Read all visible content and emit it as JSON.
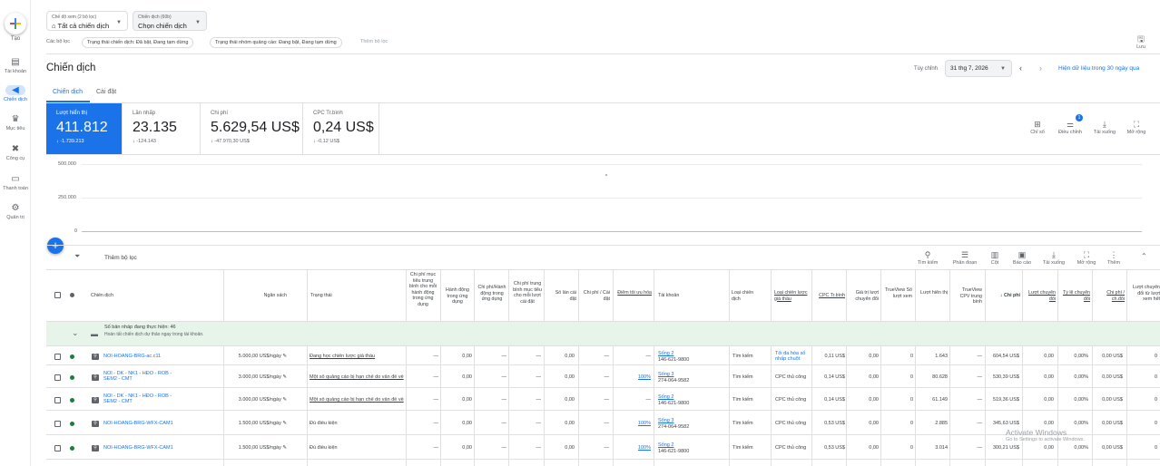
{
  "sidebar": {
    "create_label": "Tạo",
    "items": [
      {
        "label": "Tài khoản",
        "icon": "account-icon"
      },
      {
        "label": "Chiến dịch",
        "icon": "campaign-icon"
      },
      {
        "label": "Mục tiêu",
        "icon": "trophy-icon"
      },
      {
        "label": "Công cụ",
        "icon": "tools-icon"
      },
      {
        "label": "Thanh toán",
        "icon": "billing-icon"
      },
      {
        "label": "Quản trị",
        "icon": "admin-icon"
      }
    ]
  },
  "filters": {
    "view_small": "Chế độ xem (2 bộ lọc)",
    "view_value": "Tất cả chiến dịch",
    "campaign_small": "Chiến dịch (60b)",
    "campaign_value": "Chọn chiến dịch",
    "label": "Các bộ lọc",
    "chips": [
      "Trạng thái chiến dịch: Đã bật, Đang tạm dừng",
      "Trạng thái nhóm quảng cáo: Đang bật, Đang tạm dừng"
    ],
    "add": "Thêm bộ lọc",
    "save": "Lưu"
  },
  "header": {
    "title": "Chiến dịch",
    "custom": "Tùy chỉnh",
    "date": "31 thg 7, 2026",
    "show_30": "Hiện dữ liệu trong 30 ngày qua"
  },
  "tabs": [
    "Chiến dịch",
    "Cài đặt"
  ],
  "metrics": [
    {
      "label": "Lượt hiển thị",
      "value": "411.812",
      "delta": "-1.739.213"
    },
    {
      "label": "Lần nhấp",
      "value": "23.135",
      "delta": "-124.143"
    },
    {
      "label": "Chi phí",
      "value": "5.629,54 US$",
      "delta": "-47.970,30 US$"
    },
    {
      "label": "CPC Tr.bình",
      "value": "0,24 US$",
      "delta": "-0,12 US$"
    }
  ],
  "chart_tools": [
    {
      "label": "Chỉ số",
      "icon": "metrics-icon"
    },
    {
      "label": "Điều chỉnh",
      "icon": "adjust-icon",
      "badge": "1"
    },
    {
      "label": "Tải xuống",
      "icon": "download-icon"
    },
    {
      "label": "Mở rộng",
      "icon": "expand-icon"
    }
  ],
  "chart_data": {
    "type": "line",
    "ylabels": [
      "500.000",
      "250.000",
      "0"
    ],
    "ylim": [
      0,
      500000
    ],
    "series": []
  },
  "table_tools": [
    {
      "label": "Tìm kiếm",
      "icon": "search-icon"
    },
    {
      "label": "Phân đoạn",
      "icon": "segment-icon"
    },
    {
      "label": "Cột",
      "icon": "columns-icon"
    },
    {
      "label": "Báo cáo",
      "icon": "report-icon"
    },
    {
      "label": "Tải xuống",
      "icon": "download-icon"
    },
    {
      "label": "Mở rộng",
      "icon": "expand-icon"
    },
    {
      "label": "Thêm",
      "icon": "more-icon"
    }
  ],
  "add_filter": "Thêm bộ lọc",
  "columns": [
    "Chiến dịch",
    "Ngân sách",
    "Trạng thái",
    "Chi phí mục tiêu trung bình cho mỗi hành động trong ứng dụng",
    "Hành động trong ứng dụng",
    "Chi phí/Hành động trong ứng dụng",
    "Chi phí trung bình mục tiêu cho mỗi lượt cài đặt",
    "Số lần cài đặt",
    "Chi phí / Cài đặt",
    "Điểm tối ưu hóa",
    "Tài khoản",
    "Loại chiến dịch",
    "Loại chiến lược giá thầu",
    "CPC Tr.bình",
    "Giá trị lượt chuyển đổi",
    "TrueView Số lượt xem",
    "Lượt hiển thị",
    "TrueView CPV trung bình",
    "Chi phí",
    "Lượt chuyển đổi",
    "Tỷ lệ chuyển đổi",
    "Chi phí / ch.đổi",
    "Lượt chuyển đổi từ lượt xem hết"
  ],
  "drafts": {
    "title": "Số bản nháp đang thực hiện: 46",
    "sub": "Hoàn tất chiến dịch dự thảo ngay trong tài khoản."
  },
  "rows": [
    {
      "name": "NOI-HOANG-BRG-ac.c11",
      "budget": "5.000,00 US$/ngày",
      "status": "Đang học chiến lược giá thầu",
      "c1": "—",
      "c2": "0,00",
      "c3": "—",
      "c4": "—",
      "c5": "0,00",
      "c6": "—",
      "opt": "—",
      "acct": "Sống 2",
      "acct_id": "146-621-9800",
      "type": "Tìm kiếm",
      "bid": "Tối đa hóa số nhấp chuột",
      "cpc": "0,11 US$",
      "cv": "0,00",
      "tv": "0",
      "impr": "1.643",
      "cpv": "—",
      "cost": "604,54 US$",
      "conv": "0,00",
      "rate": "0,00%",
      "cpa": "0,00 US$",
      "vt": "0"
    },
    {
      "name": "NOI - DK - NK1 - HĐO - ROB - SEM2 - CMT",
      "budget": "3.000,00 US$/ngày",
      "status": "Một số quảng cáo bị hạn chế do vấn đề về",
      "c1": "—",
      "c2": "0,00",
      "c3": "—",
      "c4": "—",
      "c5": "0,00",
      "c6": "—",
      "opt": "100%",
      "acct": "Sống 3",
      "acct_id": "274-064-9582",
      "type": "Tìm kiếm",
      "bid": "CPC thủ công",
      "cpc": "0,14 US$",
      "cv": "0,00",
      "tv": "0",
      "impr": "80.628",
      "cpv": "—",
      "cost": "530,39 US$",
      "conv": "0,00",
      "rate": "0,00%",
      "cpa": "0,00 US$",
      "vt": "0"
    },
    {
      "name": "NOI - DK - NK1 - HĐO - ROB - SEM2 - CMT",
      "budget": "3.000,00 US$/ngày",
      "status": "Một số quảng cáo bị hạn chế do vấn đề về",
      "c1": "—",
      "c2": "0,00",
      "c3": "—",
      "c4": "—",
      "c5": "0,00",
      "c6": "—",
      "opt": "—",
      "acct": "Sống 2",
      "acct_id": "146-621-9800",
      "type": "Tìm kiếm",
      "bid": "CPC thủ công",
      "cpc": "0,14 US$",
      "cv": "0,00",
      "tv": "0",
      "impr": "61.149",
      "cpv": "—",
      "cost": "519,36 US$",
      "conv": "0,00",
      "rate": "0,00%",
      "cpa": "0,00 US$",
      "vt": "0"
    },
    {
      "name": "NOI-HOANG-BRG-WFX-CAM1",
      "budget": "1.500,00 US$/ngày",
      "status": "Đủ điều kiện",
      "c1": "—",
      "c2": "0,00",
      "c3": "—",
      "c4": "—",
      "c5": "0,00",
      "c6": "—",
      "opt": "100%",
      "acct": "Sống 3",
      "acct_id": "274-064-9582",
      "type": "Tìm kiếm",
      "bid": "CPC thủ công",
      "cpc": "0,53 US$",
      "cv": "0,00",
      "tv": "0",
      "impr": "2.885",
      "cpv": "—",
      "cost": "345,63 US$",
      "conv": "0,00",
      "rate": "0,00%",
      "cpa": "0,00 US$",
      "vt": "0"
    },
    {
      "name": "NOI-HOANG-BRG-WFX-CAM1",
      "budget": "1.500,00 US$/ngày",
      "status": "Đủ điều kiện",
      "c1": "—",
      "c2": "0,00",
      "c3": "—",
      "c4": "—",
      "c5": "0,00",
      "c6": "—",
      "opt": "100%",
      "acct": "Sống 2",
      "acct_id": "146-621-9800",
      "type": "Tìm kiếm",
      "bid": "CPC thủ công",
      "cpc": "0,53 US$",
      "cv": "0,00",
      "tv": "0",
      "impr": "3.014",
      "cpv": "—",
      "cost": "300,21 US$",
      "conv": "0,00",
      "rate": "0,00%",
      "cpa": "0,00 US$",
      "vt": "0"
    }
  ],
  "watermark": {
    "title": "Activate Windows",
    "sub": "Go to Settings to activate Windows."
  }
}
